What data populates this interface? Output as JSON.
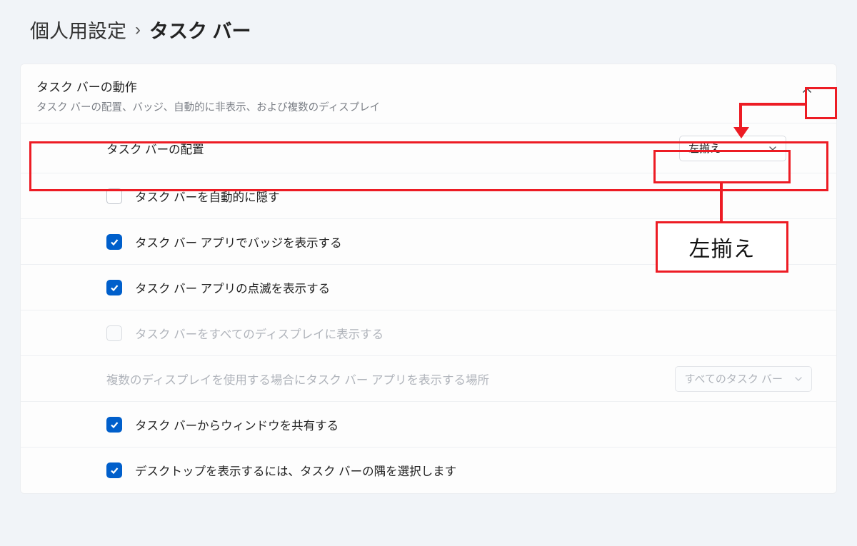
{
  "colors": {
    "accent_blue": "#005fcb",
    "anno_red": "#ed1c24"
  },
  "breadcrumb": {
    "parent": "個人用設定",
    "separator": "›",
    "current": "タスク バー"
  },
  "section": {
    "title": "タスク バーの動作",
    "subtitle": "タスク バーの配置、バッジ、自動的に非表示、および複数のディスプレイ"
  },
  "alignment": {
    "label": "タスク バーの配置",
    "value": "左揃え"
  },
  "callout": {
    "text": "左揃え"
  },
  "checks": {
    "autohide": {
      "label": "タスク バーを自動的に隠す",
      "checked": false,
      "disabled": false
    },
    "badge": {
      "label": "タスク バー アプリでバッジを表示する",
      "checked": true,
      "disabled": false
    },
    "flash": {
      "label": "タスク バー アプリの点滅を表示する",
      "checked": true,
      "disabled": false
    },
    "alldisplay": {
      "label": "タスク バーをすべてのディスプレイに表示する",
      "checked": false,
      "disabled": true
    },
    "sharewin": {
      "label": "タスク バーからウィンドウを共有する",
      "checked": true,
      "disabled": false
    },
    "showdesk": {
      "label": "デスクトップを表示するには、タスク バーの隅を選択します",
      "checked": true,
      "disabled": false
    }
  },
  "multidisplay": {
    "label": "複数のディスプレイを使用する場合にタスク バー アプリを表示する場所",
    "value": "すべてのタスク バー",
    "disabled": true
  }
}
